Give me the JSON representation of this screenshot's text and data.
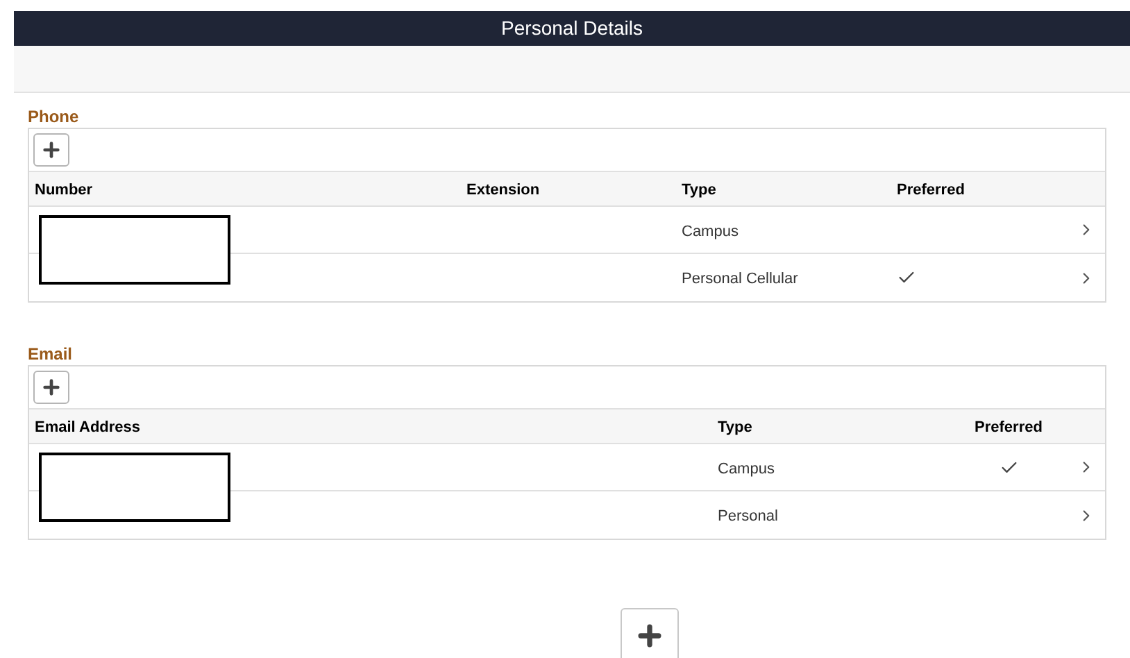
{
  "window": {
    "title": "Personal Details"
  },
  "sections": [
    {
      "title": "Phone",
      "columns": [
        "Number",
        "Extension",
        "Type",
        "Preferred"
      ],
      "rows": [
        {
          "type": "Campus",
          "preferred": false
        },
        {
          "type": "Personal Cellular",
          "preferred": true
        }
      ]
    },
    {
      "title": "Email",
      "columns": [
        "Email Address",
        "Type",
        "Preferred"
      ],
      "rows": [
        {
          "type": "Campus",
          "preferred": true
        },
        {
          "type": "Personal",
          "preferred": false
        }
      ]
    }
  ]
}
